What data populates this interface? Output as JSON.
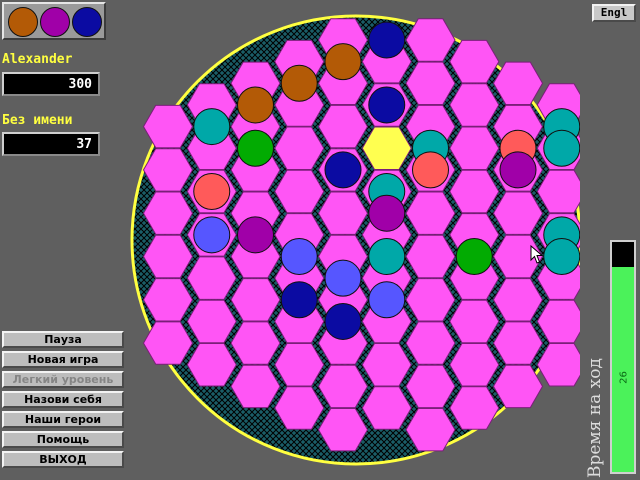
{
  "palette": {
    "colors": [
      "#b35a06",
      "#a000a8",
      "#0b0ba2"
    ],
    "names": [
      "brown-stone",
      "purple-stone",
      "blue-stone"
    ]
  },
  "players": [
    {
      "name": "Alexander",
      "score": "300"
    },
    {
      "name": "Без имени",
      "score": "37"
    }
  ],
  "menu": {
    "items": [
      {
        "label": "Пауза",
        "enabled": true
      },
      {
        "label": "Новая игра",
        "enabled": true
      },
      {
        "label": "Легкий уровень",
        "enabled": false
      },
      {
        "label": "Назови себя",
        "enabled": true
      },
      {
        "label": "Наши герои",
        "enabled": true
      },
      {
        "label": "Помощь",
        "enabled": true
      },
      {
        "label": "ВЫХОД",
        "enabled": true
      }
    ]
  },
  "language_button": "Engl",
  "timer": {
    "label": "Время на ход",
    "value": "26",
    "level": 0.89
  },
  "board": {
    "cell_color": "#ff55f5",
    "selected_cell_color": "#ffff50",
    "background_color": "#1f6f7a",
    "rim_color": "#ffff40",
    "colors": {
      "brown": "#b35a06",
      "navy": "#0b0ba2",
      "teal": "#00a8a8",
      "green": "#02ab02",
      "red": "#ff5a5a",
      "purple": "#a000a8",
      "blue": "#5656ff"
    },
    "selected": {
      "col": 5,
      "row": 5
    },
    "stones": [
      {
        "col": 5,
        "row": 0,
        "color": "navy"
      },
      {
        "col": 4,
        "row": 1,
        "color": "brown"
      },
      {
        "col": 3,
        "row": 2,
        "color": "brown"
      },
      {
        "col": 2,
        "row": 3,
        "color": "brown"
      },
      {
        "col": 5,
        "row": 3,
        "color": "navy"
      },
      {
        "col": 1,
        "row": 4,
        "color": "teal"
      },
      {
        "col": 9,
        "row": 4,
        "color": "teal"
      },
      {
        "col": 2,
        "row": 5,
        "color": "green"
      },
      {
        "col": 6,
        "row": 5,
        "color": "teal"
      },
      {
        "col": 8,
        "row": 5,
        "color": "red"
      },
      {
        "col": 9,
        "row": 5,
        "color": "teal"
      },
      {
        "col": 4,
        "row": 6,
        "color": "navy"
      },
      {
        "col": 6,
        "row": 6,
        "color": "red"
      },
      {
        "col": 8,
        "row": 6,
        "color": "purple"
      },
      {
        "col": 1,
        "row": 7,
        "color": "red"
      },
      {
        "col": 5,
        "row": 7,
        "color": "teal"
      },
      {
        "col": 5,
        "row": 8,
        "color": "purple"
      },
      {
        "col": 1,
        "row": 9,
        "color": "blue"
      },
      {
        "col": 2,
        "row": 9,
        "color": "purple"
      },
      {
        "col": 9,
        "row": 9,
        "color": "teal"
      },
      {
        "col": 3,
        "row": 10,
        "color": "blue"
      },
      {
        "col": 5,
        "row": 10,
        "color": "teal"
      },
      {
        "col": 7,
        "row": 10,
        "color": "green"
      },
      {
        "col": 9,
        "row": 10,
        "color": "teal"
      },
      {
        "col": 4,
        "row": 11,
        "color": "blue"
      },
      {
        "col": 3,
        "row": 12,
        "color": "navy"
      },
      {
        "col": 5,
        "row": 12,
        "color": "blue"
      },
      {
        "col": 4,
        "row": 13,
        "color": "navy"
      }
    ]
  }
}
